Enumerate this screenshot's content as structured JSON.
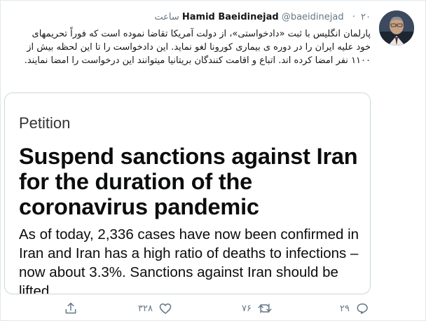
{
  "tweet": {
    "author_name": "Hamid Baeidinejad",
    "handle": "@baeidinejad",
    "separator": "·",
    "time": "۲۰ ساعت",
    "text": "پارلمان انگلیس با ثبت «دادخواستی»، از دولت آمریکا تقاضا نموده است که فوراً تحریمهای خود علیه ایران را در دوره ی بیماری کورونا لغو نماید. این دادخواست را تا این لحظه بیش از ۱۱۰۰ نفر امضا کرده اند. اتباع و اقامت کنندگان بریتانیا میتوانند این درخواست را امضا نمایند."
  },
  "card": {
    "kicker": "Petition",
    "title": "Suspend sanctions against Iran for the duration of the coronavirus pandemic",
    "body": "As of today, 2,336 cases have now been confirmed in Iran and Iran has a high ratio of deaths to infections – now about 3.3%. Sanctions against Iran should be lifted"
  },
  "actions": {
    "reply_count": "۲۹",
    "retweet_count": "۷۶",
    "like_count": "۳۲۸",
    "icons": [
      "reply-icon",
      "retweet-icon",
      "heart-icon",
      "share-icon"
    ]
  },
  "colors": {
    "text": "#14171a",
    "muted": "#657786",
    "border": "#ccd6dd"
  }
}
